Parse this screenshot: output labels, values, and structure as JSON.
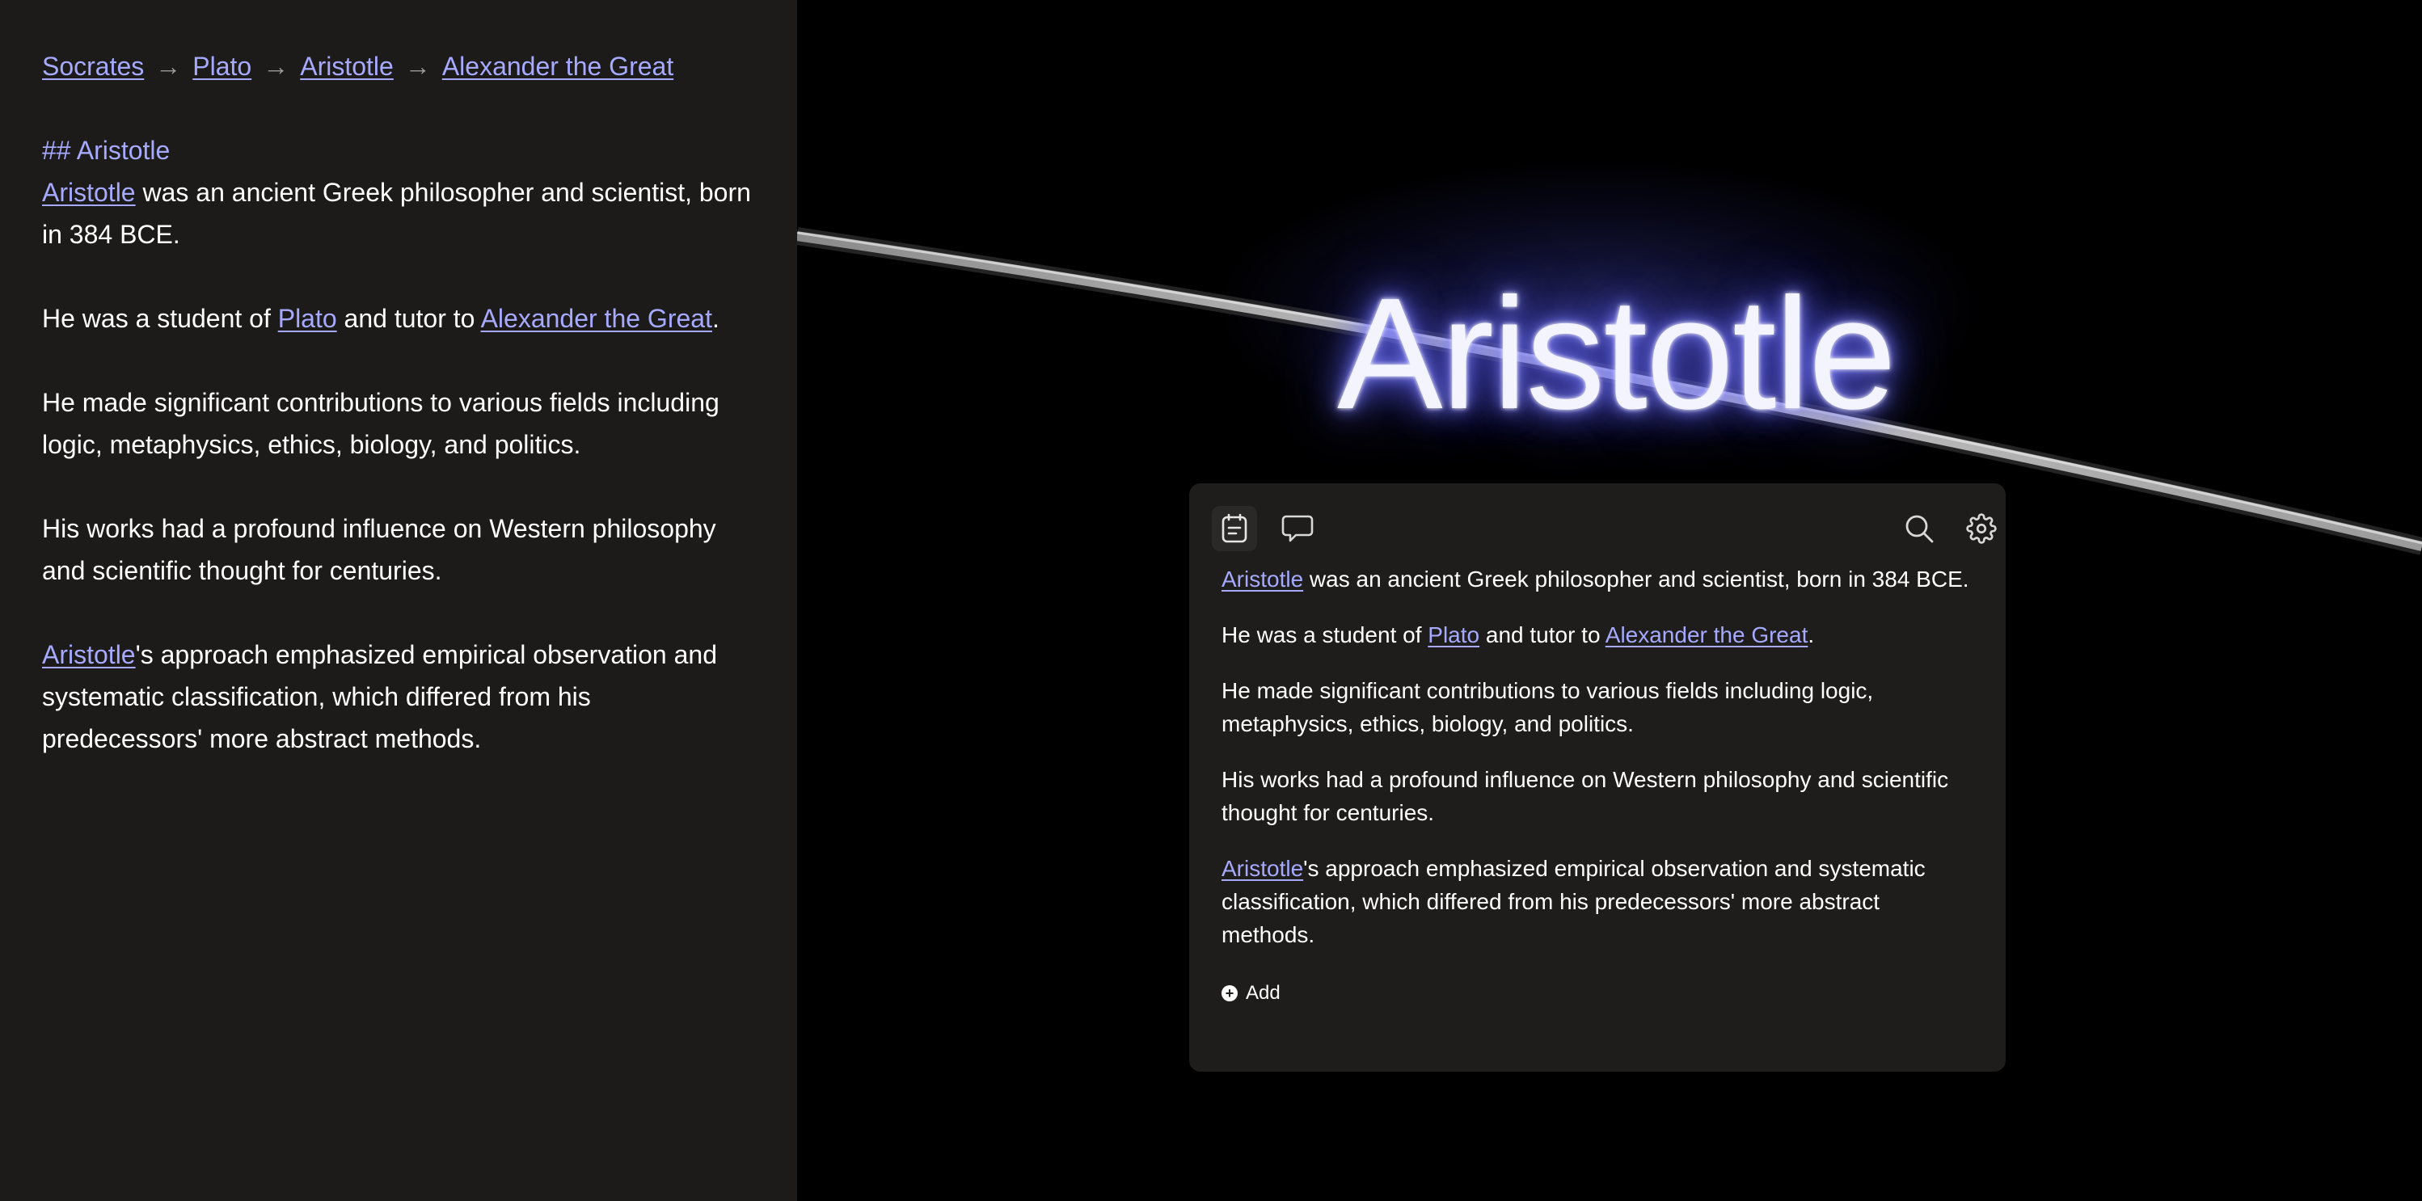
{
  "editor": {
    "breadcrumb": [
      "Socrates",
      "Plato",
      "Aristotle",
      "Alexander the Great"
    ],
    "breadcrumb_separator": "→",
    "heading": "## Aristotle",
    "p1": {
      "link": "Aristotle",
      "rest": " was an ancient Greek philosopher and scientist, born in 384 BCE."
    },
    "p2": {
      "pre": "He was a student of ",
      "link1": "Plato",
      "mid": " and tutor to ",
      "link2": "Alexander the Great",
      "post": "."
    },
    "p3": "He made significant contributions to various fields including logic, metaphysics, ethics, biology, and politics.",
    "p4": "His works had a profound influence on Western philosophy and scientific thought for centuries.",
    "p5": {
      "link": "Aristotle",
      "rest": "'s approach emphasized empirical observation and systematic classification, which differed from his predecessors' more abstract methods."
    }
  },
  "canvas": {
    "title": "Aristotle",
    "card": {
      "toolbar": {
        "left": [
          "document-icon",
          "comment-icon"
        ],
        "right": [
          "search-icon",
          "gear-icon"
        ]
      },
      "p1": {
        "link": "Aristotle",
        "rest": " was an ancient Greek philosopher and scientist, born in 384 BCE."
      },
      "p2": {
        "pre": "He was a student of ",
        "link1": "Plato",
        "mid": " and tutor to ",
        "link2": "Alexander the Great",
        "post": "."
      },
      "p3": "He made significant contributions to various fields including logic, metaphysics, ethics, biology, and politics.",
      "p4": "His works had a profound influence on Western philosophy and scientific thought for centuries.",
      "p5": {
        "link": "Aristotle",
        "rest": "'s approach emphasized empirical observation and systematic classification, which differed from his predecessors' more abstract methods."
      },
      "add_label": "Add"
    }
  },
  "colors": {
    "link": "#a6aaff",
    "panel_bg": "#1c1b19",
    "card_bg": "#1e1d1b",
    "canvas_bg": "#000000",
    "glow": "#6466ff"
  }
}
